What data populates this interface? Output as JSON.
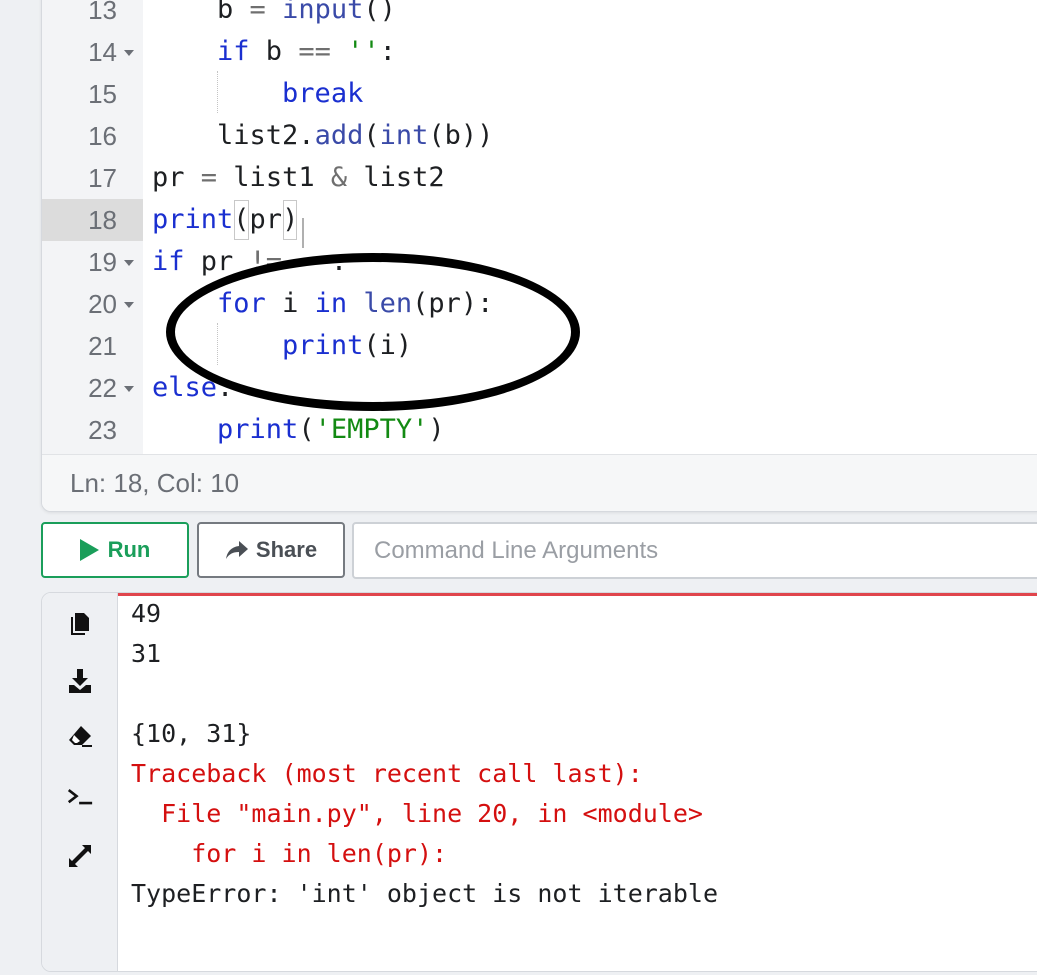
{
  "editor": {
    "lines": [
      {
        "num": "13",
        "fold": false,
        "active": false,
        "segments": [
          {
            "t": "    b ",
            "c": ""
          },
          {
            "t": "=",
            "c": "op"
          },
          {
            "t": " ",
            "c": ""
          },
          {
            "t": "input",
            "c": "fn"
          },
          {
            "t": "()",
            "c": ""
          }
        ]
      },
      {
        "num": "14",
        "fold": true,
        "active": false,
        "segments": [
          {
            "t": "    ",
            "c": ""
          },
          {
            "t": "if",
            "c": "kw"
          },
          {
            "t": " b ",
            "c": ""
          },
          {
            "t": "==",
            "c": "op"
          },
          {
            "t": " ",
            "c": ""
          },
          {
            "t": "''",
            "c": "str"
          },
          {
            "t": ":",
            "c": ""
          }
        ]
      },
      {
        "num": "15",
        "fold": false,
        "active": false,
        "segments": [
          {
            "t": "        ",
            "c": ""
          },
          {
            "t": "break",
            "c": "kw"
          }
        ]
      },
      {
        "num": "16",
        "fold": false,
        "active": false,
        "segments": [
          {
            "t": "    list2.",
            "c": ""
          },
          {
            "t": "add",
            "c": "fn"
          },
          {
            "t": "(",
            "c": ""
          },
          {
            "t": "int",
            "c": "fn"
          },
          {
            "t": "(b))",
            "c": ""
          }
        ]
      },
      {
        "num": "17",
        "fold": false,
        "active": false,
        "segments": [
          {
            "t": "pr ",
            "c": ""
          },
          {
            "t": "=",
            "c": "op"
          },
          {
            "t": " list1 ",
            "c": ""
          },
          {
            "t": "&",
            "c": "op"
          },
          {
            "t": " list2",
            "c": ""
          }
        ]
      },
      {
        "num": "18",
        "fold": false,
        "active": true,
        "segments": [
          {
            "t": "print",
            "c": "kw"
          },
          {
            "t": "(",
            "c": "bracket"
          },
          {
            "t": "pr",
            "c": ""
          },
          {
            "t": ")",
            "c": "bracket"
          }
        ]
      },
      {
        "num": "19",
        "fold": true,
        "active": false,
        "segments": [
          {
            "t": "if",
            "c": "kw"
          },
          {
            "t": " pr ",
            "c": ""
          },
          {
            "t": "!=",
            "c": "op"
          },
          {
            "t": "   :",
            "c": ""
          }
        ]
      },
      {
        "num": "20",
        "fold": true,
        "active": false,
        "segments": [
          {
            "t": "    ",
            "c": ""
          },
          {
            "t": "for",
            "c": "kw"
          },
          {
            "t": " i ",
            "c": ""
          },
          {
            "t": "in",
            "c": "kw"
          },
          {
            "t": " ",
            "c": ""
          },
          {
            "t": "len",
            "c": "fn"
          },
          {
            "t": "(pr):",
            "c": ""
          }
        ]
      },
      {
        "num": "21",
        "fold": false,
        "active": false,
        "segments": [
          {
            "t": "        ",
            "c": ""
          },
          {
            "t": "print",
            "c": "kw"
          },
          {
            "t": "(i)",
            "c": ""
          }
        ]
      },
      {
        "num": "22",
        "fold": true,
        "active": false,
        "segments": [
          {
            "t": "else",
            "c": "kw"
          },
          {
            "t": ":",
            "c": ""
          }
        ]
      },
      {
        "num": "23",
        "fold": false,
        "active": false,
        "segments": [
          {
            "t": "    ",
            "c": ""
          },
          {
            "t": "print",
            "c": "kw"
          },
          {
            "t": "(",
            "c": ""
          },
          {
            "t": "'EMPTY'",
            "c": "str"
          },
          {
            "t": ")",
            "c": ""
          }
        ]
      }
    ],
    "status": "Ln: 18,  Col: 10"
  },
  "toolbar": {
    "run_label": "Run",
    "share_label": "Share",
    "args_placeholder": "Command Line Arguments"
  },
  "output": {
    "tools": [
      "copy-icon",
      "download-icon",
      "eraser-icon",
      "terminal-icon",
      "expand-icon"
    ],
    "lines": [
      {
        "text": "49",
        "error": false
      },
      {
        "text": "31",
        "error": false
      },
      {
        "text": "",
        "error": false
      },
      {
        "text": "{10, 31}",
        "error": false
      },
      {
        "text": "Traceback (most recent call last):",
        "error": true
      },
      {
        "text": "  File \"main.py\", line 20, in <module>",
        "error": true
      },
      {
        "text": "    for i in len(pr):",
        "error": true
      },
      {
        "text": "TypeError: 'int' object is not iterable",
        "error": false
      }
    ]
  },
  "colors": {
    "keyword": "#1a2fd0",
    "string": "#138a13",
    "error": "#d40f0f",
    "run": "#1a9e5a"
  }
}
